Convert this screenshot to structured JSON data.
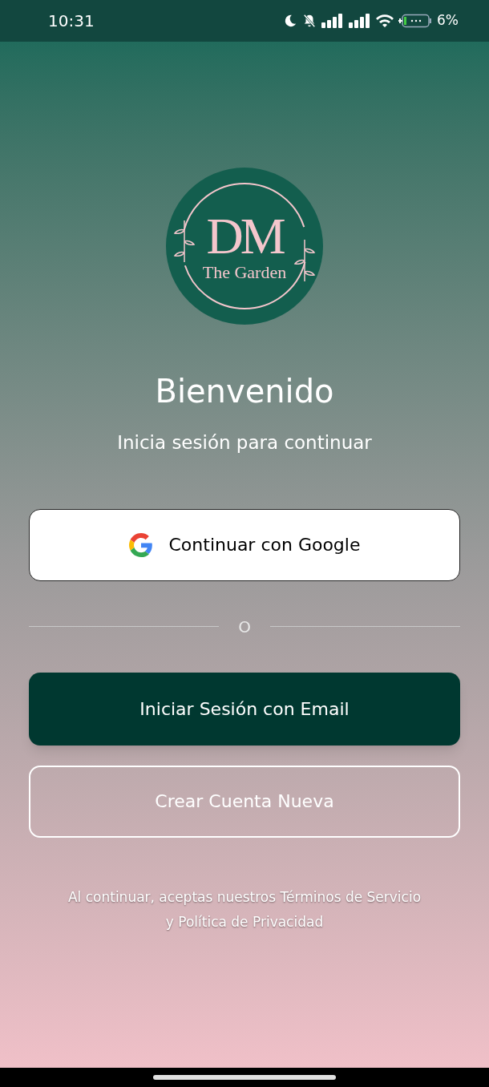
{
  "status_bar": {
    "time": "10:31",
    "battery": "6%"
  },
  "logo": {
    "initials": "DM",
    "name": "The Garden"
  },
  "title": "Bienvenido",
  "subtitle": "Inicia sesión para continuar",
  "google_button": {
    "label": "Continuar con Google"
  },
  "divider": {
    "label": "O"
  },
  "email_button": {
    "label": "Iniciar Sesión con Email"
  },
  "create_button": {
    "label": "Crear Cuenta Nueva"
  },
  "terms": {
    "lines": [
      "Al continuar, aceptas nuestros Términos de Servicio",
      "y Política de Privacidad"
    ]
  }
}
